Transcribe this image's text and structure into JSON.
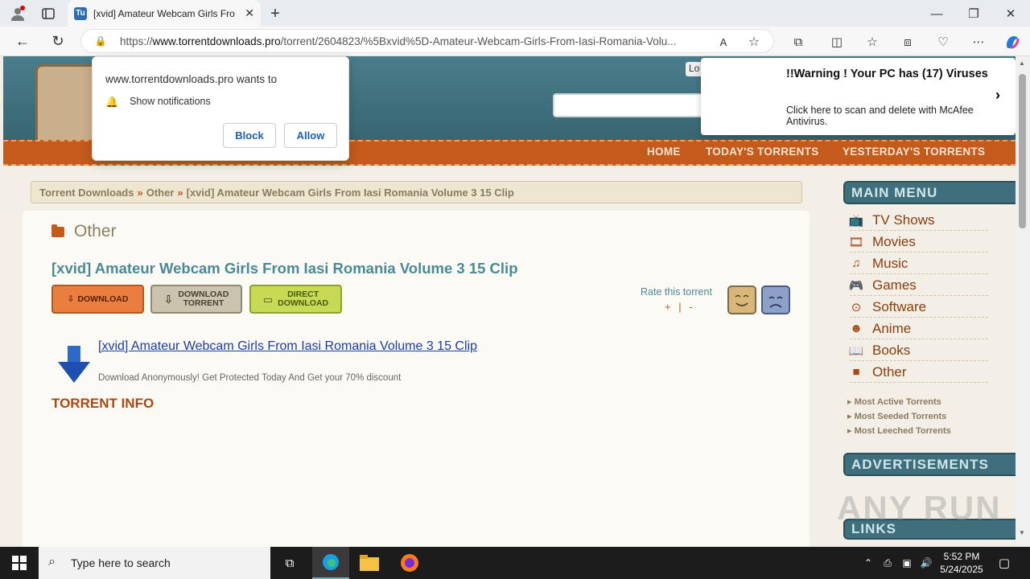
{
  "browser": {
    "tab_title": "[xvid] Amateur Webcam Girls Fro",
    "tab_favicon": "Tu",
    "url_prefix": "https://",
    "url_host": "www.torrentdownloads.pro",
    "url_path": "/torrent/2604823/%5Bxvid%5D-Amateur-Webcam-Girls-From-Iasi-Romania-Volu..."
  },
  "header": {
    "login": "Lo",
    "nav": [
      "HOME",
      "TODAY'S TORRENTS",
      "YESTERDAY'S TORRENTS"
    ]
  },
  "breadcrumb": {
    "items": [
      "Torrent Downloads",
      "Other",
      "[xvid] Amateur Webcam Girls From Iasi Romania Volume 3 15 Clip"
    ],
    "sep": "»"
  },
  "main": {
    "category": "Other",
    "title": "[xvid] Amateur Webcam Girls From Iasi Romania Volume 3 15 Clip",
    "btn_download": "DOWNLOAD",
    "btn_download_torrent_1": "DOWNLOAD",
    "btn_download_torrent_2": "TORRENT",
    "btn_direct_1": "DIRECT",
    "btn_direct_2": "DOWNLOAD",
    "rate_label": "Rate this torrent",
    "rate_plus": "+",
    "rate_sep": "|",
    "rate_minus": "-",
    "download_link": "[xvid] Amateur Webcam Girls From Iasi Romania Volume 3 15 Clip",
    "anon_text": "Download Anonymously! Get Protected Today And Get your 70% discount",
    "torrent_info": "TORRENT INFO"
  },
  "sidebar": {
    "main_menu": "MAIN MENU",
    "items": [
      {
        "label": "TV Shows",
        "icon": "tv-icon"
      },
      {
        "label": "Movies",
        "icon": "film-icon"
      },
      {
        "label": "Music",
        "icon": "music-icon"
      },
      {
        "label": "Games",
        "icon": "gamepad-icon"
      },
      {
        "label": "Software",
        "icon": "software-icon"
      },
      {
        "label": "Anime",
        "icon": "anime-icon"
      },
      {
        "label": "Books",
        "icon": "book-icon"
      },
      {
        "label": "Other",
        "icon": "folder-icon"
      }
    ],
    "links": [
      "Most Active Torrents",
      "Most Seeded Torrents",
      "Most Leeched Torrents"
    ],
    "advertisements": "ADVERTISEMENTS",
    "links_head": "LINKS"
  },
  "notification_popup": {
    "title": "www.torrentdownloads.pro wants to",
    "permission": "Show notifications",
    "block": "Block",
    "allow": "Allow"
  },
  "warning_popup": {
    "heading": "!!Warning ! Your PC has (17) Viruses",
    "body": "Click here to scan and delete with McAfee Antivirus."
  },
  "taskbar": {
    "search_placeholder": "Type here to search",
    "time": "5:52 PM",
    "date": "5/24/2025"
  },
  "watermark": "ANY RUN",
  "colors": {
    "accent": "#c45a1c",
    "header": "#3a6a78",
    "link": "#1a3da6"
  }
}
